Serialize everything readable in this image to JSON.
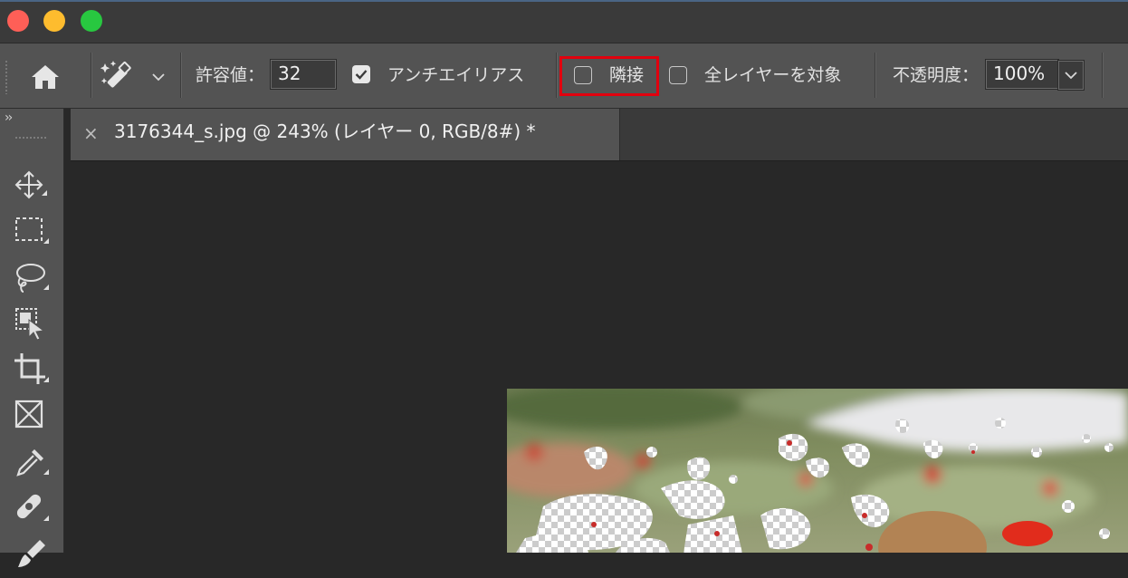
{
  "window": {
    "controls": [
      "close",
      "minimize",
      "maximize"
    ],
    "colors": {
      "close": "#fe5f57",
      "minimize": "#febc2e",
      "maximize": "#28c840"
    }
  },
  "options_bar": {
    "home_icon": "home-icon",
    "tool_icon": "magic-wand-icon",
    "tolerance_label": "許容値：",
    "tolerance_value": "32",
    "anti_alias_label": "アンチエイリアス",
    "anti_alias_checked": true,
    "contiguous_label": "隣接",
    "contiguous_checked": false,
    "sample_all_layers_label": "全レイヤーを対象",
    "sample_all_layers_checked": false,
    "opacity_label": "不透明度：",
    "opacity_value": "100%",
    "highlight_color": "#e1000e"
  },
  "toolbar": {
    "collapse": "››",
    "tools": [
      "move-tool",
      "rectangular-marquee-tool",
      "lasso-tool",
      "object-selection-tool",
      "crop-tool",
      "frame-tool",
      "eyedropper-tool",
      "spot-healing-brush-tool",
      "brush-tool"
    ]
  },
  "document": {
    "tab_close": "×",
    "tab_title": "3176344_s.jpg @ 243% (レイヤー 0, RGB/8#) *"
  }
}
